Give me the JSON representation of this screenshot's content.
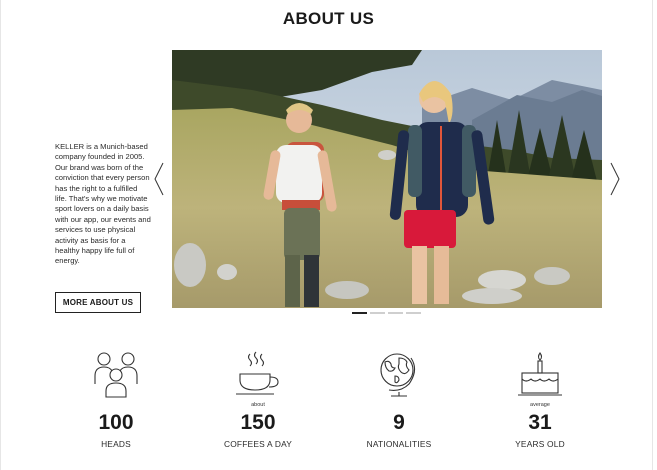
{
  "page": {
    "title": "ABOUT US"
  },
  "intro": {
    "text": "KELLER is a Munich-based company founded in 2005. Our brand was born of the conviction that every person has the right to a fulfilled life. That's why we motivate sport lovers on a daily basis with our app, our events and services to use physical activity as basis for a healthy happy life full of energy.",
    "button_label": "MORE ABOUT US"
  },
  "slider": {
    "image_icon": "hikers-photo",
    "dots_count": 4,
    "active_dot": 0
  },
  "stats": [
    {
      "icon": "people-icon",
      "prefix": "",
      "value": "100",
      "label": "HEADS"
    },
    {
      "icon": "coffee-cup-icon",
      "prefix": "about",
      "value": "150",
      "label": "COFFEES A DAY"
    },
    {
      "icon": "globe-icon",
      "prefix": "",
      "value": "9",
      "label": "NATIONALITIES"
    },
    {
      "icon": "birthday-cake-icon",
      "prefix": "average",
      "value": "31",
      "label": "YEARS OLD"
    }
  ],
  "colors": {
    "text": "#1a1a1a",
    "accent": "#d8193a",
    "border": "#222222"
  }
}
